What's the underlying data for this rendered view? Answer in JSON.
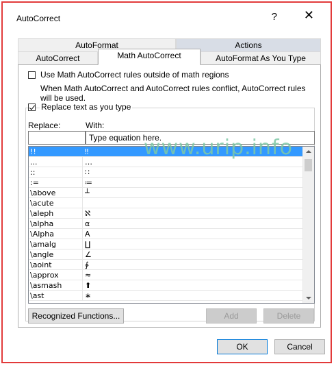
{
  "window": {
    "title": "AutoCorrect",
    "help_label": "?",
    "close_label": "✕"
  },
  "tabs": {
    "row1": [
      "AutoFormat",
      "Actions"
    ],
    "row2": [
      "AutoCorrect",
      "Math AutoCorrect",
      "AutoFormat As You Type"
    ],
    "active": "Math AutoCorrect"
  },
  "options": {
    "use_outside_label": "Use Math AutoCorrect rules outside of math regions",
    "use_outside_checked": false,
    "conflict_note": "When Math AutoCorrect and AutoCorrect rules conflict, AutoCorrect rules will be used.",
    "replace_label": "Replace text as you type",
    "replace_checked": true
  },
  "fields": {
    "replace_header": "Replace:",
    "with_header": "With:",
    "replace_value": "",
    "with_value": "Type equation here."
  },
  "watermark": "www.urip.info",
  "list": {
    "rows": [
      {
        "replace": "!!",
        "with": "‼",
        "selected": true
      },
      {
        "replace": "...",
        "with": "…"
      },
      {
        "replace": "::",
        "with": "∷"
      },
      {
        "replace": ":=",
        "with": "≔"
      },
      {
        "replace": "\\above",
        "with": "┴"
      },
      {
        "replace": "\\acute",
        "with": "́"
      },
      {
        "replace": "\\aleph",
        "with": "ℵ"
      },
      {
        "replace": "\\alpha",
        "with": "α"
      },
      {
        "replace": "\\Alpha",
        "with": "Α"
      },
      {
        "replace": "\\amalg",
        "with": "∐"
      },
      {
        "replace": "\\angle",
        "with": "∠"
      },
      {
        "replace": "\\aoint",
        "with": "∳"
      },
      {
        "replace": "\\approx",
        "with": "≈"
      },
      {
        "replace": "\\asmash",
        "with": "⬆"
      },
      {
        "replace": "\\ast",
        "with": "∗"
      }
    ]
  },
  "buttons": {
    "recognized": "Recognized Functions...",
    "add": "Add",
    "delete": "Delete",
    "ok": "OK",
    "cancel": "Cancel"
  }
}
